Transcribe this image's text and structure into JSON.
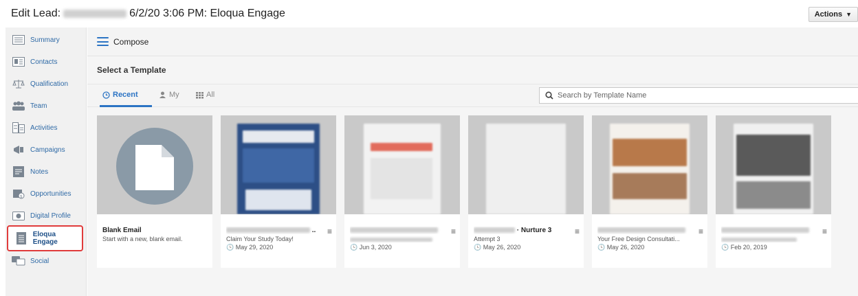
{
  "header": {
    "title_prefix": "Edit Lead:",
    "title_suffix": "6/2/20 3:06 PM: Eloqua Engage",
    "actions_label": "Actions",
    "actions_caret": "▼"
  },
  "sidebar": {
    "items": [
      {
        "label": "Summary",
        "icon": "summary-icon"
      },
      {
        "label": "Contacts",
        "icon": "contacts-icon"
      },
      {
        "label": "Qualification",
        "icon": "scale-icon"
      },
      {
        "label": "Team",
        "icon": "team-icon"
      },
      {
        "label": "Activities",
        "icon": "activities-icon"
      },
      {
        "label": "Campaigns",
        "icon": "megaphone-icon"
      },
      {
        "label": "Notes",
        "icon": "notes-icon"
      },
      {
        "label": "Opportunities",
        "icon": "opportunities-icon"
      },
      {
        "label": "Digital Profile",
        "icon": "camera-icon"
      },
      {
        "label": "Eloqua Engage",
        "icon": "document-icon",
        "active": true
      },
      {
        "label": "Social",
        "icon": "social-icon"
      }
    ]
  },
  "compose": {
    "label": "Compose"
  },
  "templates": {
    "section_title": "Select a Template",
    "tabs": [
      {
        "label": "Recent",
        "icon": "clock-icon"
      },
      {
        "label": "My",
        "icon": "user-icon"
      },
      {
        "label": "All",
        "icon": "grid-icon"
      }
    ],
    "search_placeholder": "Search by Template Name",
    "cards": [
      {
        "name": "Blank Email",
        "subject": "Start with a new, blank email.",
        "date": ""
      },
      {
        "name": "",
        "subject": "Claim Your Study Today!",
        "date": "May 29, 2020"
      },
      {
        "name": "",
        "subject": "",
        "date": "Jun 3, 2020"
      },
      {
        "name": "· Nurture 3",
        "subject": "Attempt 3",
        "date": "May 26, 2020"
      },
      {
        "name": "",
        "subject": "Your Free Design Consultati...",
        "date": "May 26, 2020"
      },
      {
        "name": "",
        "subject": "",
        "date": "Feb 20, 2019"
      }
    ],
    "clock_glyph": "🕓",
    "menu_glyph": "≡"
  },
  "colors": {
    "accent": "#2c74c4",
    "active_outline": "#e03b3b",
    "nav_link": "#2f6aa6"
  }
}
